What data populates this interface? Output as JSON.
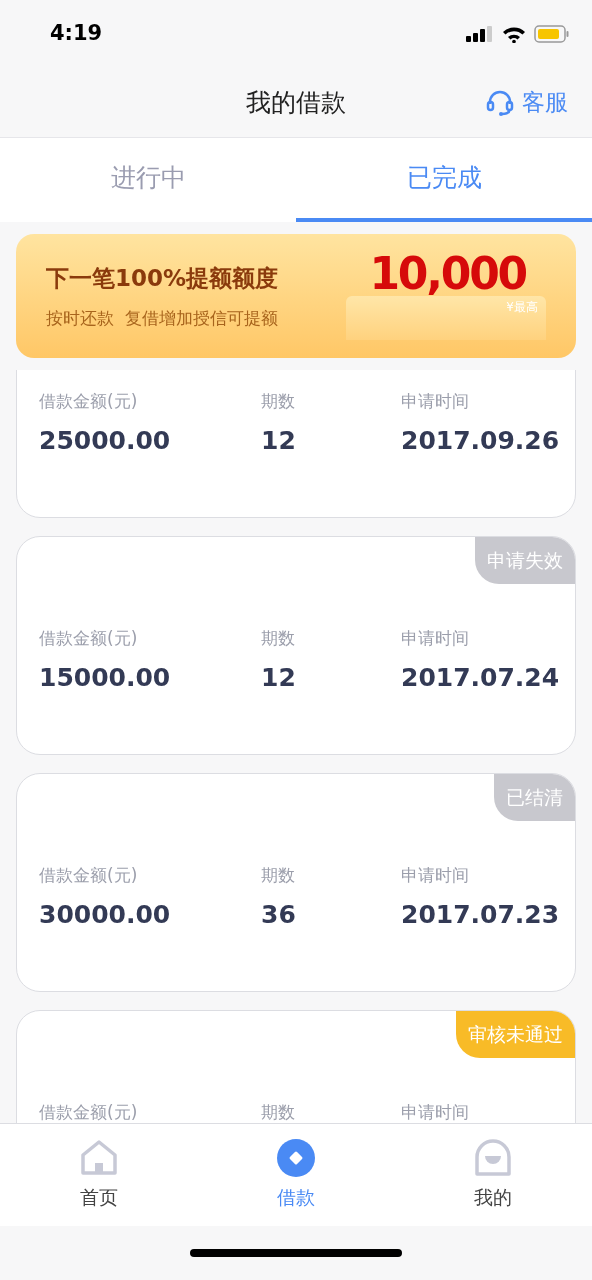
{
  "status_bar": {
    "time": "4:19"
  },
  "header": {
    "title": "我的借款",
    "service": "客服"
  },
  "tabs": [
    {
      "label": "进行中",
      "selected": false
    },
    {
      "label": "已完成",
      "selected": true
    }
  ],
  "banner": {
    "headline": "下一笔**100%**提额额度",
    "subline": "按时还款  复借增加授信可提额",
    "amount": "10,000",
    "amount_note": "¥最高"
  },
  "loans": [
    {
      "amount_label": "借款金额(元)",
      "amount": "25000.00",
      "periods_label": "期数",
      "periods": "12",
      "date_label": "申请时间",
      "date": "2017.09.26"
    },
    {
      "status": "申请失效",
      "color": "#c8c8ce",
      "amount_label": "借款金额(元)",
      "amount": "15000.00",
      "periods_label": "期数",
      "periods": "12",
      "date_label": "申请时间",
      "date": "2017.07.24"
    },
    {
      "status": "已结清",
      "color": "#c8c8ce",
      "amount_label": "借款金额(元)",
      "amount": "30000.00",
      "periods_label": "期数",
      "periods": "36",
      "date_label": "申请时间",
      "date": "2017.07.23"
    },
    {
      "status": "审核未通过",
      "color": "#f8bb27",
      "amount_label": "借款金额(元)",
      "periods_label": "期数",
      "date_label": "申请时间"
    }
  ],
  "bottom_nav": [
    {
      "label": "首页",
      "kind": "home",
      "selected": false
    },
    {
      "label": "借款",
      "kind": "loan",
      "selected": true
    },
    {
      "label": "我的",
      "kind": "me",
      "selected": false
    }
  ]
}
